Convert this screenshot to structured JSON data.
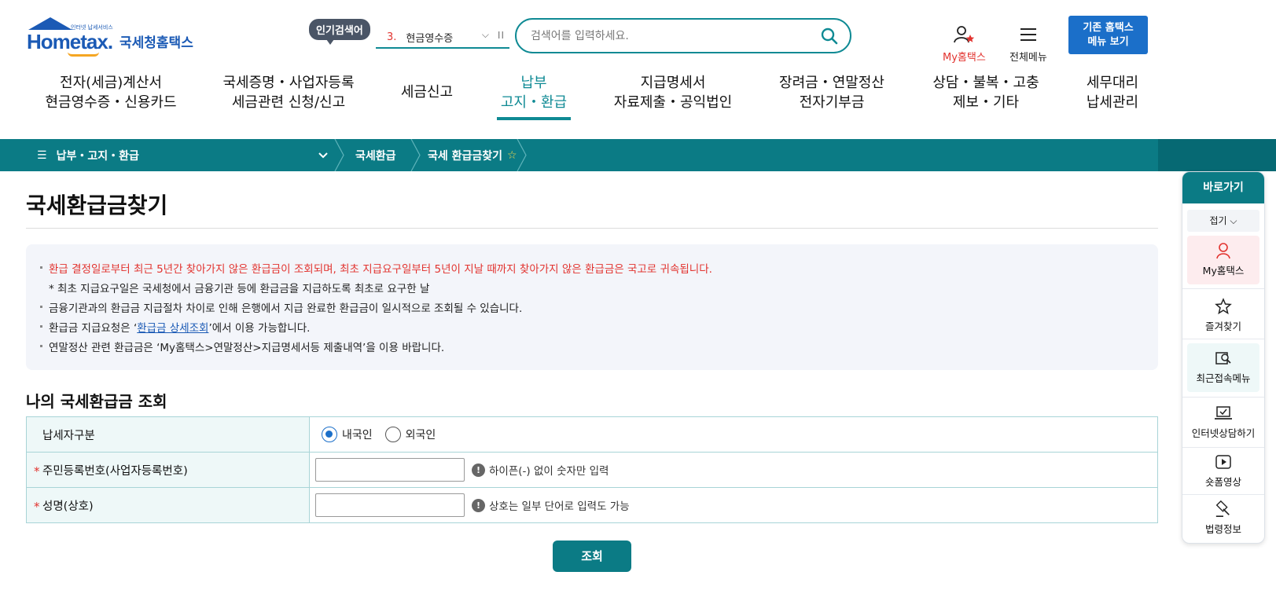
{
  "header": {
    "logo_tagline": "인터넷 납세서비스",
    "logo_word": "Hometax.",
    "logo_korean": "국세청홈택스",
    "popular_badge": "인기검색어",
    "popular_rank": "3.",
    "popular_term": "현금영수증",
    "search_placeholder": "검색어를 입력하세요.",
    "my_hometax": "My홈택스",
    "all_menu": "전체메뉴",
    "legacy_line1": "기존 홈택스",
    "legacy_line2": "메뉴 보기"
  },
  "gnb": [
    {
      "line1": "전자(세금)계산서",
      "line2": "현금영수증・신용카드"
    },
    {
      "line1": "국세증명・사업자등록",
      "line2": "세금관련 신청/신고"
    },
    {
      "line1": "세금신고",
      "line2": ""
    },
    {
      "line1": "납부",
      "line2": "고지・환급"
    },
    {
      "line1": "지급명세서",
      "line2": "자료제출・공익법인"
    },
    {
      "line1": "장려금・연말정산",
      "line2": "전자기부금"
    },
    {
      "line1": "상담・불복・고충",
      "line2": "제보・기타"
    },
    {
      "line1": "세무대리",
      "line2": "납세관리"
    }
  ],
  "breadcrumb": {
    "menu": "납부・고지・환급",
    "level2": "국세환급",
    "level3": "국세 환급금찾기"
  },
  "page": {
    "title": "국세환급금찾기",
    "notices": [
      "환급 결정일로부터 최근 5년간 찾아가지 않은 환급금이 조회되며, 최초 지급요구일부터 5년이 지날 때까지 찾아가지 않은 환급금은 국고로 귀속됩니다.",
      "* 최초 지급요구일은 국세청에서 금융기관 등에 환급금을 지급하도록 최초로 요구한 날",
      "금융기관과의 환급금 지급절차 차이로 인해 은행에서 지급 완료한 환급금이 일시적으로 조회될 수 있습니다.",
      "연말정산 관련 환급금은 ‘My홈택스>연말정산>지급명세서등 제출내역’을 이용 바랍니다."
    ],
    "notice_link_prefix": "환급금 지급요청은 ‘",
    "notice_link_text": "환급금 상세조회",
    "notice_link_suffix": "’에서 이용 가능합니다.",
    "section_title": "나의 국세환급금 조회"
  },
  "form": {
    "taxpayer_type_label": "납세자구분",
    "radio_domestic": "내국인",
    "radio_foreign": "외국인",
    "selected": "내국인",
    "id_label": "주민등록번호(사업자등록번호)",
    "id_hint": "하이픈(-) 없이 숫자만 입력",
    "id_value": "",
    "name_label": "성명(상호)",
    "name_hint": "상호는 일부 단어로 입력도 가능",
    "name_value": "",
    "required_mark": "*",
    "submit": "조회"
  },
  "quick_menu": {
    "title": "바로가기",
    "fold": "접기",
    "items": [
      "My홈택스",
      "즐겨찾기",
      "최근접속메뉴",
      "인터넷상담하기",
      "숏폼영상",
      "법령정보"
    ]
  },
  "colors": {
    "primary_teal": "#0b7b85",
    "brand_blue": "#1b5ab5",
    "alert_red": "#e2332f"
  }
}
